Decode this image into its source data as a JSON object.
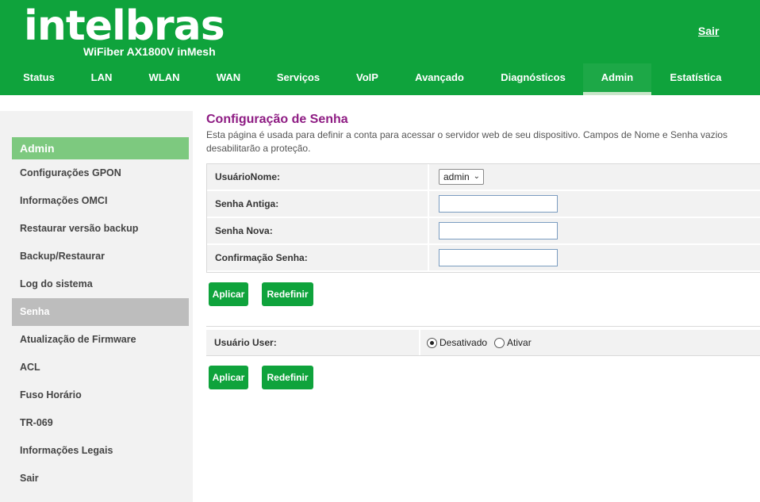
{
  "header": {
    "logo": "intelbras",
    "model": "WiFiber AX1800V inMesh",
    "logout_label": "Sair"
  },
  "nav": [
    {
      "label": "Status"
    },
    {
      "label": "LAN"
    },
    {
      "label": "WLAN"
    },
    {
      "label": "WAN"
    },
    {
      "label": "Serviços"
    },
    {
      "label": "VoIP"
    },
    {
      "label": "Avançado"
    },
    {
      "label": "Diagnósticos"
    },
    {
      "label": "Admin",
      "active": true
    },
    {
      "label": "Estatística"
    }
  ],
  "sidebar": {
    "title": "Admin",
    "items": [
      {
        "label": "Configurações GPON"
      },
      {
        "label": "Informações OMCI"
      },
      {
        "label": "Restaurar versão backup"
      },
      {
        "label": "Backup/Restaurar"
      },
      {
        "label": "Log do sistema"
      },
      {
        "label": "Senha",
        "active": true
      },
      {
        "label": "Atualização de Firmware"
      },
      {
        "label": "ACL"
      },
      {
        "label": "Fuso Horário"
      },
      {
        "label": "TR-069"
      },
      {
        "label": "Informações Legais"
      },
      {
        "label": "Sair"
      }
    ]
  },
  "main": {
    "title": "Configuração de Senha",
    "description": "Esta página é usada para definir a conta para acessar o servidor web de seu dispositivo. Campos de Nome e Senha vazios desabilitarão a proteção.",
    "form": {
      "username_label": "UsuárioNome:",
      "username_value": "admin",
      "old_password_label": "Senha Antiga:",
      "old_password_value": "",
      "new_password_label": "Senha Nova:",
      "new_password_value": "",
      "confirm_password_label": "Confirmação Senha:",
      "confirm_password_value": ""
    },
    "apply_label": "Aplicar",
    "reset_label": "Redefinir",
    "user_section": {
      "label": "Usuário User:",
      "option_disabled": "Desativado",
      "option_enabled": "Ativar",
      "selected": "Desativado"
    }
  },
  "colors": {
    "brand_green": "#0fa33c",
    "sidebar_title_green": "#7dc97f",
    "title_purple": "#8e1c83"
  }
}
